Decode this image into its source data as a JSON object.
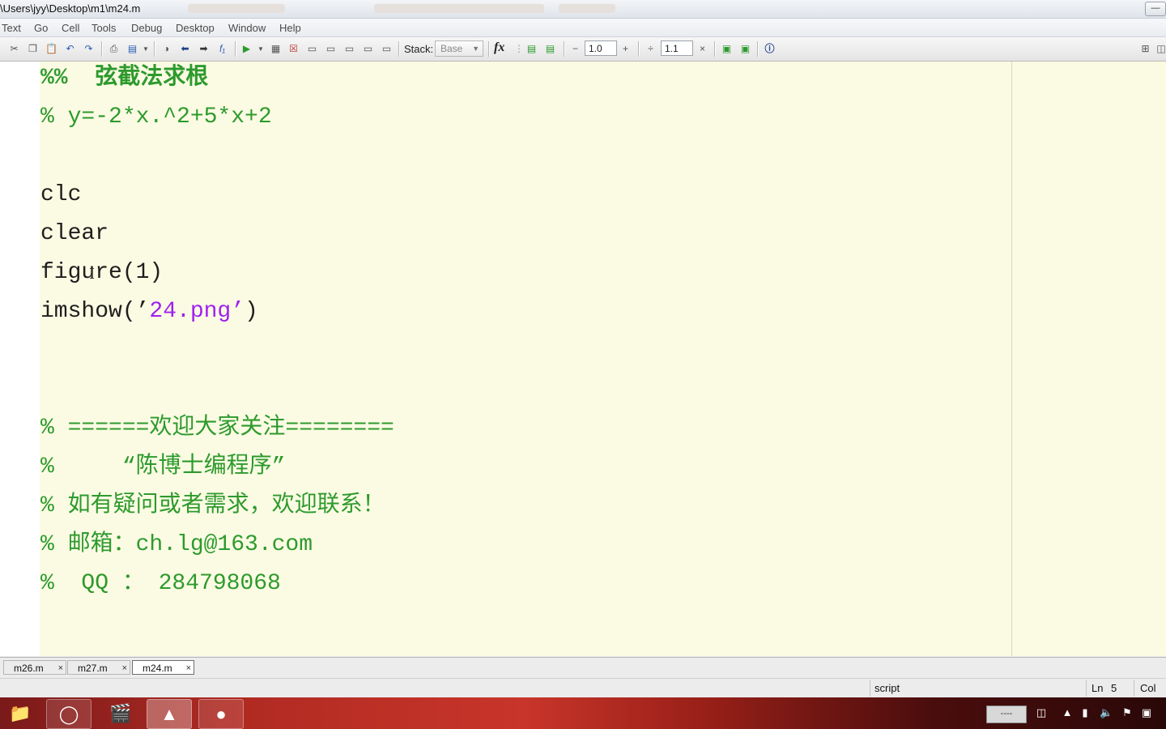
{
  "window": {
    "title": "\\Users\\jyy\\Desktop\\m1\\m24.m"
  },
  "menu": [
    "Text",
    "Go",
    "Cell",
    "Tools",
    "Debug",
    "Desktop",
    "Window",
    "Help"
  ],
  "toolbar": {
    "stack_label": "Stack:",
    "stack_value": "Base",
    "fx_label": "fx",
    "minus_label": "−",
    "cell_value_1": "1.0",
    "plus_label": "+",
    "divide_label": "÷",
    "cell_value_2": "1.1",
    "times_label": "×"
  },
  "editor": {
    "lines": [
      {
        "kind": "cell",
        "text": "%%  弦截法求根"
      },
      {
        "kind": "comment",
        "text": "% y=-2*x.^2+5*x+2"
      },
      {
        "kind": "code",
        "text": "clc"
      },
      {
        "kind": "code",
        "text": "clear"
      },
      {
        "kind": "code",
        "text": "figure(1)"
      },
      {
        "kind": "mixed",
        "before": "imshow(’",
        "string": "24.png’",
        "after": ")"
      },
      {
        "kind": "comment",
        "text": "% ======欢迎大家关注========"
      },
      {
        "kind": "comment",
        "text": "%     “陈博士编程序”"
      },
      {
        "kind": "comment",
        "text": "% 如有疑问或者需求，欢迎联系！"
      },
      {
        "kind": "comment",
        "text": "% 邮箱：ch.lg@163.com"
      },
      {
        "kind": "comment",
        "text": "%  QQ ： 284798068"
      }
    ]
  },
  "tabs": [
    {
      "label": "m26.m",
      "active": false
    },
    {
      "label": "m27.m",
      "active": false
    },
    {
      "label": "m24.m",
      "active": true
    }
  ],
  "status": {
    "mode": "script",
    "ln_label": "Ln",
    "ln_value": "5",
    "col_label": "Col"
  },
  "taskbar": {
    "tray_text": "----"
  },
  "colors": {
    "editor_bg": "#fbfbe3",
    "comment": "#2d9a2d",
    "string": "#a020f0",
    "code": "#1e1e1e"
  }
}
